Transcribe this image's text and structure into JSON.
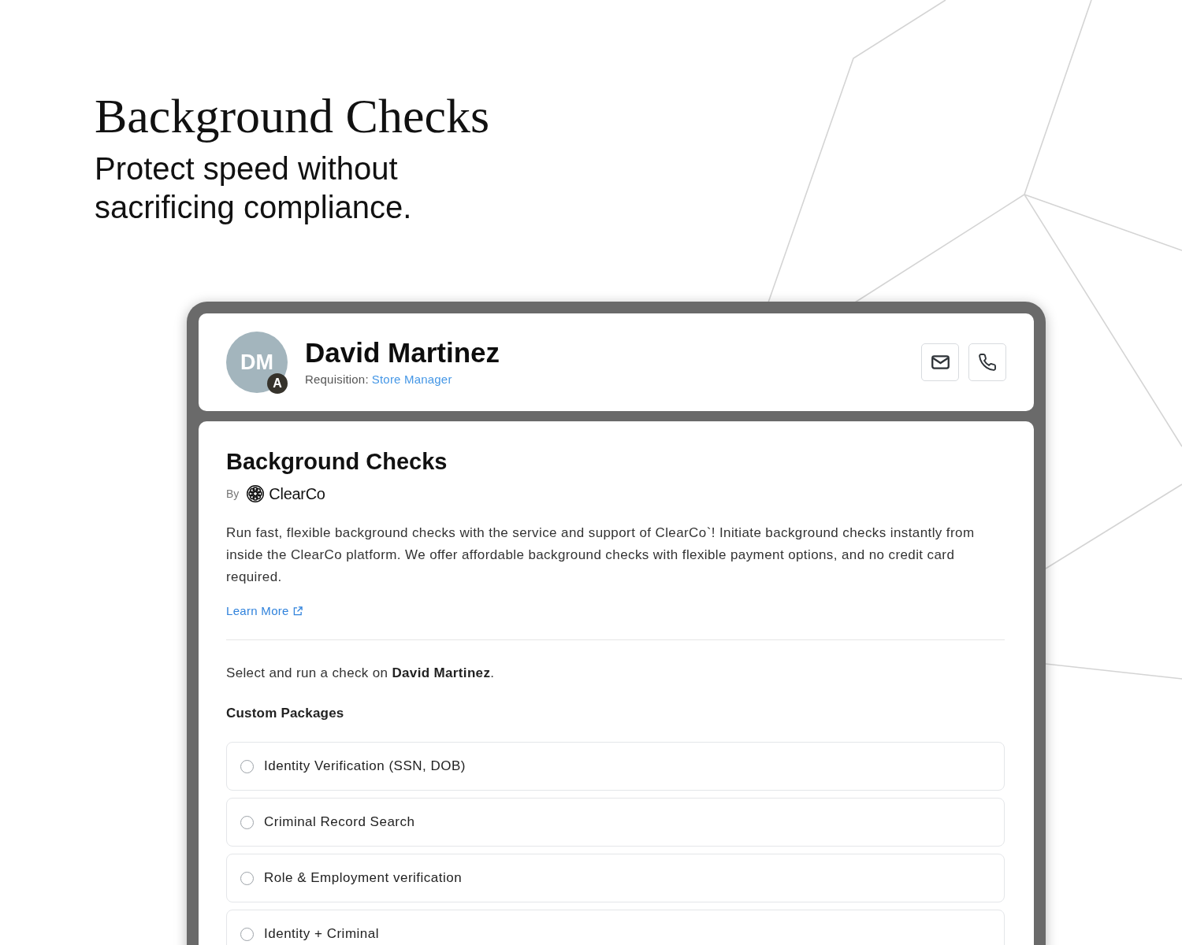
{
  "hero": {
    "title": "Background Checks",
    "subtitle": "Protect speed without sacrificing compliance."
  },
  "candidate": {
    "initials": "DM",
    "badge": "A",
    "name": "David Martinez",
    "requisition_label": "Requisition:",
    "requisition": "Store Manager"
  },
  "integration": {
    "title": "Background Checks",
    "by_label": "By",
    "provider": "ClearCo",
    "description": "Run fast, flexible background checks with the service and support of ClearCo`! Initiate background checks instantly from inside the ClearCo platform. We offer affordable background checks with flexible payment options, and no credit card required.",
    "link": "Learn More",
    "prompt": "Select and run a check on **David Martinez**.",
    "section_title": "Custom Packages",
    "packages": [
      {
        "label": "Identity Verification (SSN, DOB)",
        "selected": false
      },
      {
        "label": "Criminal Record Search",
        "selected": false
      },
      {
        "label": "Role & Employment verification",
        "selected": false
      },
      {
        "label": "Identity + Criminal",
        "selected": false
      }
    ]
  }
}
